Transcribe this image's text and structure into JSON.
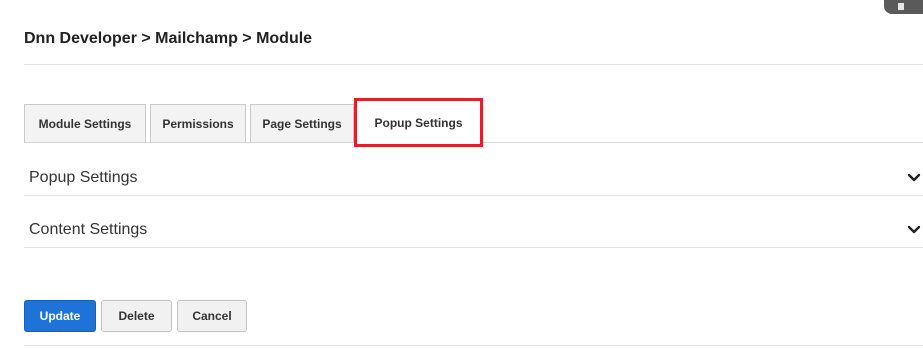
{
  "breadcrumb": "Dnn Developer > Mailchamp > Module",
  "tabs": [
    {
      "label": "Module Settings"
    },
    {
      "label": "Permissions"
    },
    {
      "label": "Page Settings"
    },
    {
      "label": "Popup Settings",
      "active": true
    }
  ],
  "sections": [
    {
      "label": "Popup Settings",
      "icon": "chevron-down-icon"
    },
    {
      "label": "Content Settings",
      "icon": "chevron-down-icon"
    }
  ],
  "actions": {
    "update_label": "Update",
    "delete_label": "Delete",
    "cancel_label": "Cancel"
  },
  "colors": {
    "primary_button": "#1e73d8",
    "highlight_box": "#e0202a"
  }
}
